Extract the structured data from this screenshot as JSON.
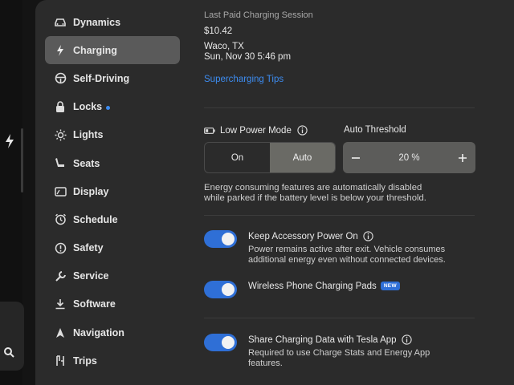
{
  "sidebar": {
    "items": [
      {
        "label": "Dynamics",
        "icon": "car-icon"
      },
      {
        "label": "Charging",
        "icon": "bolt-icon",
        "active": true
      },
      {
        "label": "Self-Driving",
        "icon": "steering-wheel-icon"
      },
      {
        "label": "Locks",
        "icon": "lock-icon",
        "dot": true
      },
      {
        "label": "Lights",
        "icon": "sun-icon"
      },
      {
        "label": "Seats",
        "icon": "seat-icon"
      },
      {
        "label": "Display",
        "icon": "display-icon"
      },
      {
        "label": "Schedule",
        "icon": "alarm-clock-icon"
      },
      {
        "label": "Safety",
        "icon": "alert-circle-icon"
      },
      {
        "label": "Service",
        "icon": "wrench-icon"
      },
      {
        "label": "Software",
        "icon": "download-icon"
      },
      {
        "label": "Navigation",
        "icon": "navigation-arrow-icon"
      },
      {
        "label": "Trips",
        "icon": "trips-icon"
      }
    ]
  },
  "session": {
    "heading": "Last Paid Charging Session",
    "amount": "$10.42",
    "location": "Waco, TX",
    "datetime": "Sun, Nov 30 5:46 pm",
    "tips_link": "Supercharging Tips"
  },
  "low_power": {
    "label": "Low Power Mode",
    "options": [
      "On",
      "Auto"
    ],
    "selected": "Auto",
    "threshold_label": "Auto Threshold",
    "threshold_value": "20 %",
    "description_line1": "Energy consuming features are automatically disabled",
    "description_line2": "while parked if the battery level is below your threshold."
  },
  "accessory": {
    "label": "Keep Accessory Power On",
    "desc_line1": "Power remains active after exit. Vehicle consumes",
    "desc_line2": "additional energy even without connected devices.",
    "on": true
  },
  "wireless": {
    "label": "Wireless Phone Charging Pads",
    "badge": "NEW",
    "on": true
  },
  "share": {
    "label": "Share Charging Data with Tesla App",
    "desc_line1": "Required to use Charge Stats and Energy App",
    "desc_line2": "features.",
    "on": true
  },
  "colors": {
    "accent": "#2f6fd6",
    "link": "#3d8cf0",
    "panel": "#2b2b2b"
  }
}
